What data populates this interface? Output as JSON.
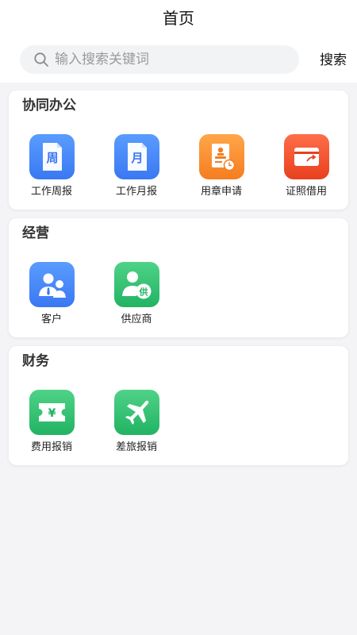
{
  "header": {
    "title": "首页"
  },
  "search": {
    "placeholder": "输入搜索关键词",
    "button_label": "搜索"
  },
  "sections": [
    {
      "title": "协同办公",
      "items": [
        {
          "label": "工作周报",
          "icon": "weekly-report-icon",
          "glyph": "周",
          "color": "#3a78f2"
        },
        {
          "label": "工作月报",
          "icon": "monthly-report-icon",
          "glyph": "月",
          "color": "#3a78f2"
        },
        {
          "label": "用章申请",
          "icon": "seal-request-icon",
          "color": "#f57d1f"
        },
        {
          "label": "证照借用",
          "icon": "license-borrow-icon",
          "color": "#e8401e"
        }
      ]
    },
    {
      "title": "经营",
      "items": [
        {
          "label": "客户",
          "icon": "customer-icon",
          "color": "#3a78f2"
        },
        {
          "label": "供应商",
          "icon": "supplier-icon",
          "glyph": "供",
          "color": "#22b363"
        }
      ]
    },
    {
      "title": "财务",
      "items": [
        {
          "label": "费用报销",
          "icon": "expense-ticket-icon",
          "glyph": "¥",
          "color": "#22b363"
        },
        {
          "label": "差旅报销",
          "icon": "travel-plane-icon",
          "color": "#22b363"
        }
      ]
    }
  ]
}
